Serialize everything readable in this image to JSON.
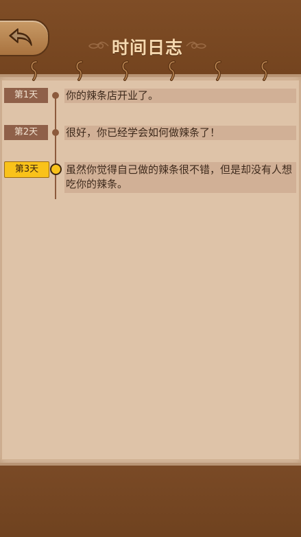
{
  "header": {
    "title": "时间日志",
    "back_icon": "back-arrow-icon"
  },
  "colors": {
    "wood": "#7a4a26",
    "paper": "#dec3a8",
    "tag_inactive": "#8f6049",
    "tag_active": "#f9c21a",
    "entry_bg": "#d1b096"
  },
  "timeline": {
    "entries": [
      {
        "day": "第1天",
        "text": "你的辣条店开业了。",
        "active": false
      },
      {
        "day": "第2天",
        "text": "很好，你已经学会如何做辣条了！",
        "active": false
      },
      {
        "day": "第3天",
        "text": "虽然你觉得自己做的辣条很不错，但是却没有人想吃你的辣条。",
        "active": true
      }
    ]
  }
}
